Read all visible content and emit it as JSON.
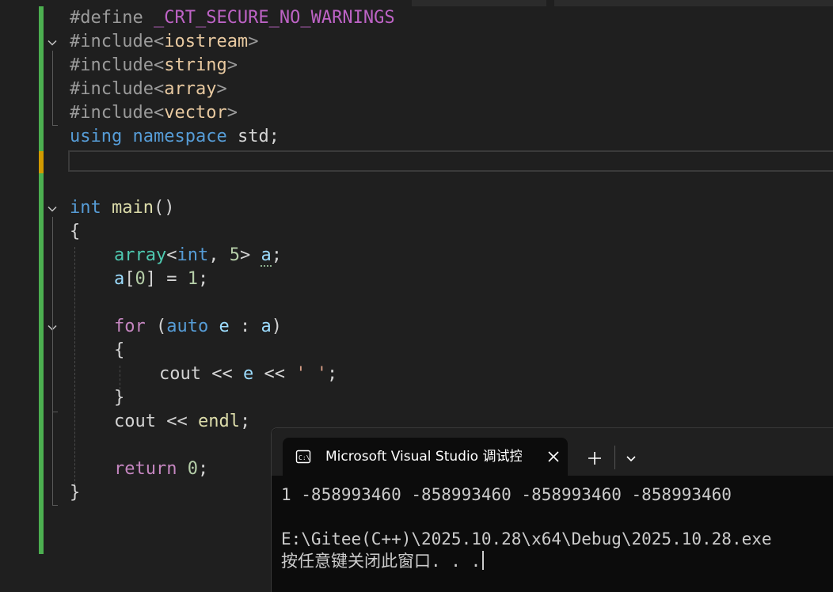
{
  "editor": {
    "lines": {
      "l1": {
        "pp": "#define ",
        "macro": "_CRT_SECURE_NO_WARNINGS"
      },
      "l2": {
        "pp": "#include",
        "open": "<",
        "hdr": "iostream",
        "close": ">"
      },
      "l3": {
        "pp": "#include",
        "open": "<",
        "hdr": "string",
        "close": ">"
      },
      "l4": {
        "pp": "#include",
        "open": "<",
        "hdr": "array",
        "close": ">"
      },
      "l5": {
        "pp": "#include",
        "open": "<",
        "hdr": "vector",
        "close": ">"
      },
      "l6": {
        "kw1": "using",
        "kw2": "namespace",
        "rest": " std;"
      },
      "l8": {
        "kw": "int",
        "fn": "main",
        "rest": "()"
      },
      "l9": {
        "text": "{"
      },
      "l10": {
        "type": "array",
        "lt": "<",
        "kw": "int",
        "comma": ", ",
        "num": "5",
        "gt": "> ",
        "var": "a",
        "semi": ";"
      },
      "l11": {
        "var": "a",
        "open": "[",
        "num0": "0",
        "mid": "] = ",
        "num1": "1",
        "semi": ";"
      },
      "l13": {
        "kw": "for",
        "open": " (",
        "kw2": "auto",
        "sp": " ",
        "var1": "e",
        "colon": " : ",
        "var2": "a",
        "close": ")"
      },
      "l14": {
        "text": "{"
      },
      "l15": {
        "ident": "cout",
        "op1": " << ",
        "var": "e",
        "op2": " << ",
        "str": "' '",
        "semi": ";"
      },
      "l16": {
        "text": "}"
      },
      "l17": {
        "ident": "cout",
        "op": " << ",
        "endl": "endl",
        "semi": ";"
      },
      "l19": {
        "kw": "return",
        "sp": " ",
        "num": "0",
        "semi": ";"
      },
      "l20": {
        "text": "}"
      }
    },
    "icons": {
      "fold": "chevron-down-icon"
    },
    "colors": {
      "change_bar": "#4caf50",
      "change_bar_unsaved": "#d19a00",
      "background": "#1f1f1f"
    }
  },
  "console": {
    "tab_title": "Microsoft Visual Studio 调试控",
    "tab_icon": "console-icon",
    "close_icon": "close-icon",
    "new_tab_icon": "plus-icon",
    "dropdown_icon": "chevron-down-icon",
    "output": [
      "1 -858993460 -858993460 -858993460 -858993460",
      "",
      "E:\\Gitee(C++)\\2025.10.28\\x64\\Debug\\2025.10.28.exe",
      "按任意键关闭此窗口. . ."
    ],
    "colors": {
      "background": "#0c0c0c",
      "titlebar": "#202020",
      "text": "#cccccc"
    }
  }
}
